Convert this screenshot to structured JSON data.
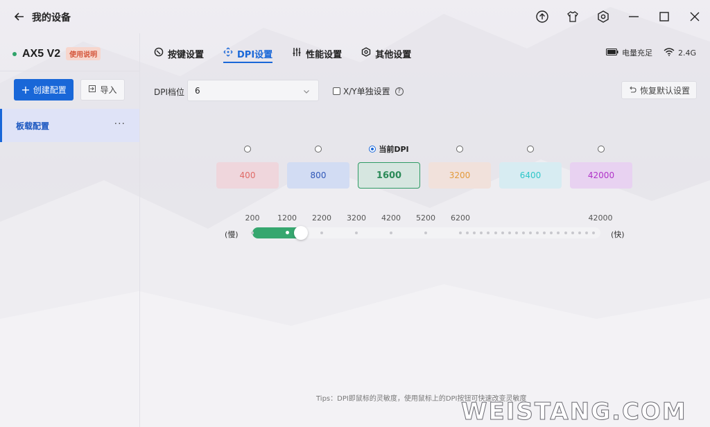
{
  "window": {
    "title": "我的设备"
  },
  "sidebar": {
    "device_name": "AX5 V2",
    "manual_badge": "使用说明",
    "create_label": "创建配置",
    "import_label": "导入",
    "profile_label": "板载配置"
  },
  "tabs": [
    {
      "label": "按键设置",
      "icon": "mouse-icon",
      "active": false
    },
    {
      "label": "DPI设置",
      "icon": "dpi-icon",
      "active": true
    },
    {
      "label": "性能设置",
      "icon": "sliders-icon",
      "active": false
    },
    {
      "label": "其他设置",
      "icon": "hexagon-gear-icon",
      "active": false
    }
  ],
  "status": {
    "battery": "电量充足",
    "wireless": "2.4G"
  },
  "dpi": {
    "level_label": "DPI档位",
    "level_value": "6",
    "xy_label": "X/Y单独设置",
    "reset_label": "恢复默认设置",
    "current_label": "当前DPI",
    "selected_index": 2,
    "levels": [
      {
        "value": "400",
        "color": "#e06a66",
        "bg": "#efd6dc"
      },
      {
        "value": "800",
        "color": "#2f57b8",
        "bg": "#d2dcf3"
      },
      {
        "value": "1600",
        "color": "#2b8a58",
        "bg": "#d6e6e0"
      },
      {
        "value": "3200",
        "color": "#e39a3a",
        "bg": "#f1e1db"
      },
      {
        "value": "6400",
        "color": "#2ec7c9",
        "bg": "#d7ecf2"
      },
      {
        "value": "42000",
        "color": "#b033c8",
        "bg": "#e8d2f1"
      }
    ]
  },
  "slider": {
    "slow_label": "(慢)",
    "fast_label": "(快)",
    "tick_labels": [
      "200",
      "1200",
      "2200",
      "3200",
      "4200",
      "5200",
      "6200",
      "42000"
    ],
    "value": 1600,
    "min": 200,
    "max": 42000
  },
  "tips": "Tips：DPI即鼠标的灵敏度，使用鼠标上的DPI按钮可快速改变灵敏度",
  "watermark": "WEISTANG.COM"
}
